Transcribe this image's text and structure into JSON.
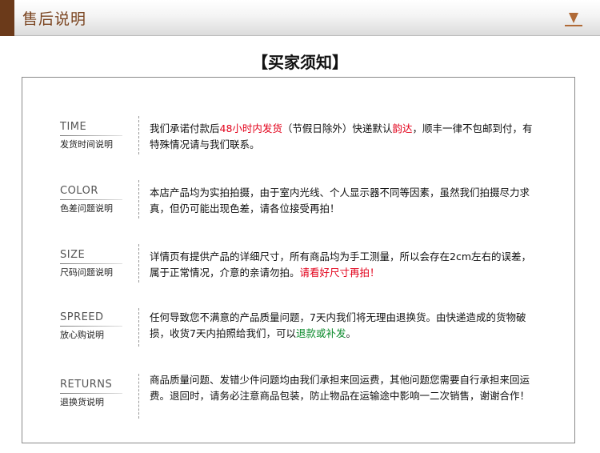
{
  "header": {
    "title": "售后说明"
  },
  "notice": {
    "title": "【买家须知】"
  },
  "colors": {
    "header_accent": "#6b3a1a",
    "header_text": "#7a4420",
    "highlight_red": "#e2001a",
    "highlight_green": "#0b8a2b"
  },
  "sections": [
    {
      "label_en": "TIME",
      "label_cn": "发货时间说明",
      "t1": "我们承诺付款后",
      "t2": "48小时内发货",
      "t3": "（节假日除外）快递默认",
      "t4": "韵达",
      "t5": "，顺丰一律不包邮到付，有特殊情况请与我们联系。"
    },
    {
      "label_en": "COLOR",
      "label_cn": "色差问题说明",
      "t1": "本店产品均为实拍拍摄，由于室内光线、个人显示器不同等因素，虽然我们拍摄尽力求真，但仍可能出现色差，请各位接受再拍！"
    },
    {
      "label_en": "SIZE",
      "label_cn": "尺码问题说明",
      "t1": "详情页有提供产品的详细尺寸，所有商品均为手工测量，所以会存在2cm左右的误差，属于正常情况，介意的亲请勿拍。",
      "t2": "请看好尺寸再拍！"
    },
    {
      "label_en": "SPREED",
      "label_cn": "放心购说明",
      "t1": "任何导致您不满意的产品质量问题，7天内我们将无理由退换货。由快递造成的货物破损，收货7天内拍照给我们，可以",
      "t2": "退款或补发",
      "t3": "。"
    },
    {
      "label_en": "RETURNS",
      "label_cn": "退换货说明",
      "t1": "商品质量问题、发错少件问题均由我们承担来回运费，其他问题您需要自行承担来回运费。退回时，请务必注意商品包装，防止物品在运输途中影响一二次销售，谢谢合作！"
    }
  ]
}
